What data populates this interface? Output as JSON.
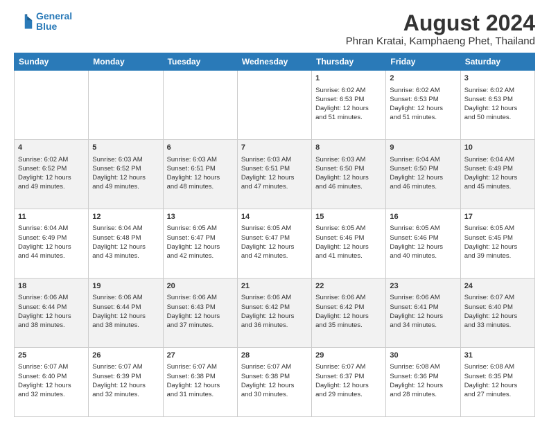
{
  "header": {
    "logo_line1": "General",
    "logo_line2": "Blue",
    "main_title": "August 2024",
    "sub_title": "Phran Kratai, Kamphaeng Phet, Thailand"
  },
  "days_of_week": [
    "Sunday",
    "Monday",
    "Tuesday",
    "Wednesday",
    "Thursday",
    "Friday",
    "Saturday"
  ],
  "weeks": [
    [
      {
        "day": "",
        "info": ""
      },
      {
        "day": "",
        "info": ""
      },
      {
        "day": "",
        "info": ""
      },
      {
        "day": "",
        "info": ""
      },
      {
        "day": "1",
        "info": "Sunrise: 6:02 AM\nSunset: 6:53 PM\nDaylight: 12 hours\nand 51 minutes."
      },
      {
        "day": "2",
        "info": "Sunrise: 6:02 AM\nSunset: 6:53 PM\nDaylight: 12 hours\nand 51 minutes."
      },
      {
        "day": "3",
        "info": "Sunrise: 6:02 AM\nSunset: 6:53 PM\nDaylight: 12 hours\nand 50 minutes."
      }
    ],
    [
      {
        "day": "4",
        "info": "Sunrise: 6:02 AM\nSunset: 6:52 PM\nDaylight: 12 hours\nand 49 minutes."
      },
      {
        "day": "5",
        "info": "Sunrise: 6:03 AM\nSunset: 6:52 PM\nDaylight: 12 hours\nand 49 minutes."
      },
      {
        "day": "6",
        "info": "Sunrise: 6:03 AM\nSunset: 6:51 PM\nDaylight: 12 hours\nand 48 minutes."
      },
      {
        "day": "7",
        "info": "Sunrise: 6:03 AM\nSunset: 6:51 PM\nDaylight: 12 hours\nand 47 minutes."
      },
      {
        "day": "8",
        "info": "Sunrise: 6:03 AM\nSunset: 6:50 PM\nDaylight: 12 hours\nand 46 minutes."
      },
      {
        "day": "9",
        "info": "Sunrise: 6:04 AM\nSunset: 6:50 PM\nDaylight: 12 hours\nand 46 minutes."
      },
      {
        "day": "10",
        "info": "Sunrise: 6:04 AM\nSunset: 6:49 PM\nDaylight: 12 hours\nand 45 minutes."
      }
    ],
    [
      {
        "day": "11",
        "info": "Sunrise: 6:04 AM\nSunset: 6:49 PM\nDaylight: 12 hours\nand 44 minutes."
      },
      {
        "day": "12",
        "info": "Sunrise: 6:04 AM\nSunset: 6:48 PM\nDaylight: 12 hours\nand 43 minutes."
      },
      {
        "day": "13",
        "info": "Sunrise: 6:05 AM\nSunset: 6:47 PM\nDaylight: 12 hours\nand 42 minutes."
      },
      {
        "day": "14",
        "info": "Sunrise: 6:05 AM\nSunset: 6:47 PM\nDaylight: 12 hours\nand 42 minutes."
      },
      {
        "day": "15",
        "info": "Sunrise: 6:05 AM\nSunset: 6:46 PM\nDaylight: 12 hours\nand 41 minutes."
      },
      {
        "day": "16",
        "info": "Sunrise: 6:05 AM\nSunset: 6:46 PM\nDaylight: 12 hours\nand 40 minutes."
      },
      {
        "day": "17",
        "info": "Sunrise: 6:05 AM\nSunset: 6:45 PM\nDaylight: 12 hours\nand 39 minutes."
      }
    ],
    [
      {
        "day": "18",
        "info": "Sunrise: 6:06 AM\nSunset: 6:44 PM\nDaylight: 12 hours\nand 38 minutes."
      },
      {
        "day": "19",
        "info": "Sunrise: 6:06 AM\nSunset: 6:44 PM\nDaylight: 12 hours\nand 38 minutes."
      },
      {
        "day": "20",
        "info": "Sunrise: 6:06 AM\nSunset: 6:43 PM\nDaylight: 12 hours\nand 37 minutes."
      },
      {
        "day": "21",
        "info": "Sunrise: 6:06 AM\nSunset: 6:42 PM\nDaylight: 12 hours\nand 36 minutes."
      },
      {
        "day": "22",
        "info": "Sunrise: 6:06 AM\nSunset: 6:42 PM\nDaylight: 12 hours\nand 35 minutes."
      },
      {
        "day": "23",
        "info": "Sunrise: 6:06 AM\nSunset: 6:41 PM\nDaylight: 12 hours\nand 34 minutes."
      },
      {
        "day": "24",
        "info": "Sunrise: 6:07 AM\nSunset: 6:40 PM\nDaylight: 12 hours\nand 33 minutes."
      }
    ],
    [
      {
        "day": "25",
        "info": "Sunrise: 6:07 AM\nSunset: 6:40 PM\nDaylight: 12 hours\nand 32 minutes."
      },
      {
        "day": "26",
        "info": "Sunrise: 6:07 AM\nSunset: 6:39 PM\nDaylight: 12 hours\nand 32 minutes."
      },
      {
        "day": "27",
        "info": "Sunrise: 6:07 AM\nSunset: 6:38 PM\nDaylight: 12 hours\nand 31 minutes."
      },
      {
        "day": "28",
        "info": "Sunrise: 6:07 AM\nSunset: 6:38 PM\nDaylight: 12 hours\nand 30 minutes."
      },
      {
        "day": "29",
        "info": "Sunrise: 6:07 AM\nSunset: 6:37 PM\nDaylight: 12 hours\nand 29 minutes."
      },
      {
        "day": "30",
        "info": "Sunrise: 6:08 AM\nSunset: 6:36 PM\nDaylight: 12 hours\nand 28 minutes."
      },
      {
        "day": "31",
        "info": "Sunrise: 6:08 AM\nSunset: 6:35 PM\nDaylight: 12 hours\nand 27 minutes."
      }
    ]
  ]
}
